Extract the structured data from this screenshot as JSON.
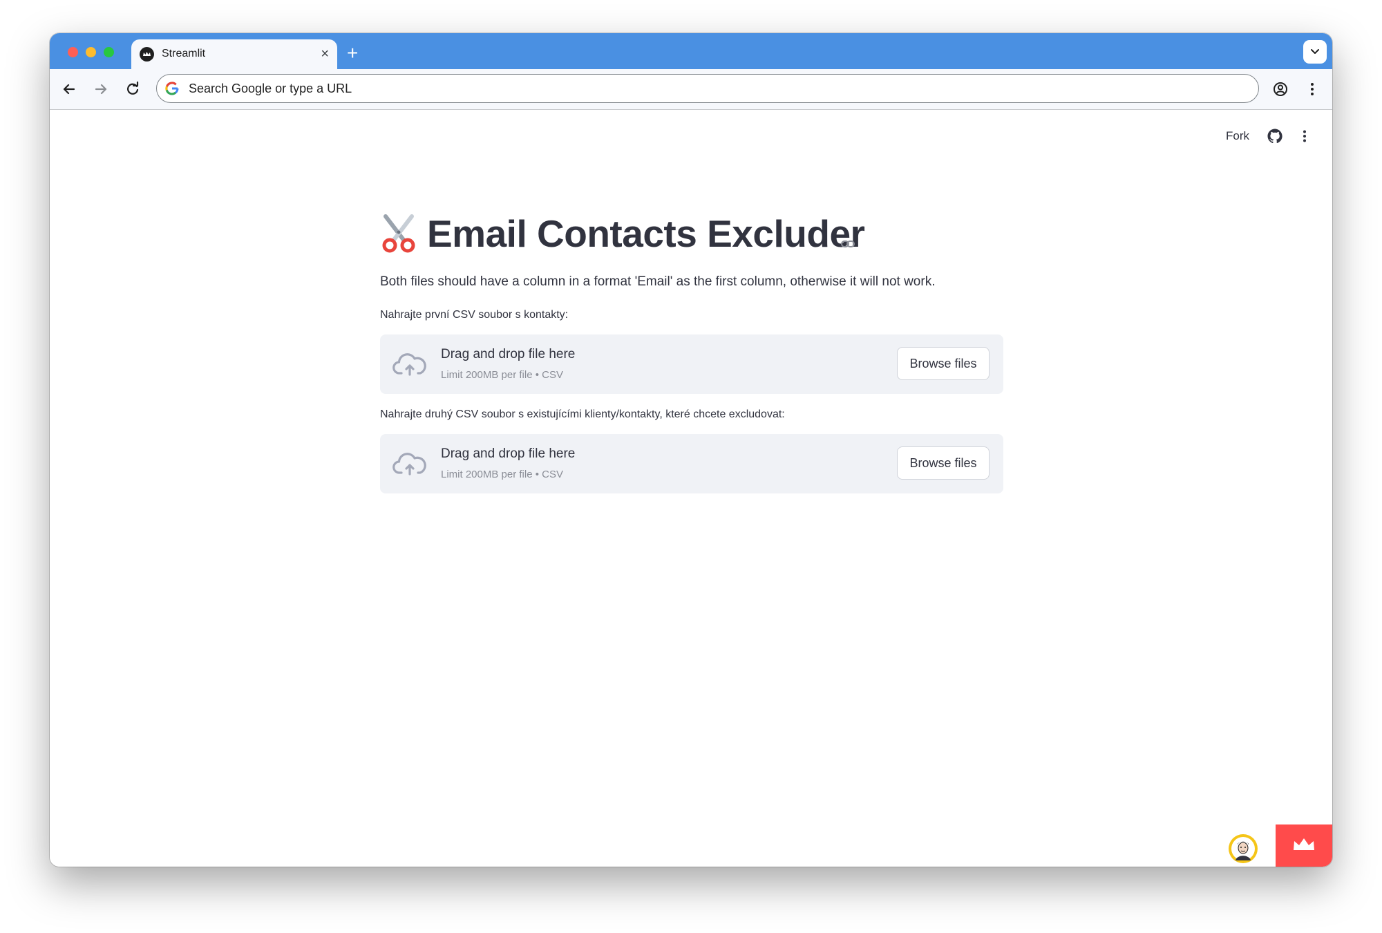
{
  "browser": {
    "tab_title": "Streamlit",
    "new_tab_symbol": "+",
    "close_symbol": "×",
    "address_placeholder": "Search Google or type a URL"
  },
  "app_header": {
    "fork_label": "Fork"
  },
  "main": {
    "title": "Email Contacts Excluder",
    "description": "Both files should have a column in a format 'Email' as the first column, otherwise it will not work."
  },
  "uploaders": [
    {
      "label": "Nahrajte první CSV soubor s kontakty:",
      "drop_text": "Drag and drop file here",
      "limit_text": "Limit 200MB per file • CSV",
      "button_label": "Browse files"
    },
    {
      "label": "Nahrajte druhý CSV soubor s existujícími klienty/kontakty, které chcete excludovat:",
      "drop_text": "Drag and drop file here",
      "limit_text": "Limit 200MB per file • CSV",
      "button_label": "Browse files"
    }
  ],
  "colors": {
    "tab_bar": "#4a90e2",
    "streamlit_red": "#ff4b4b",
    "text": "#31333f",
    "dropzone_bg": "#f0f2f6"
  },
  "icons": [
    "streamlit-favicon-icon",
    "back-arrow-icon",
    "forward-arrow-icon",
    "reload-icon",
    "google-icon",
    "profile-icon",
    "chrome-menu-icon",
    "github-icon",
    "kebab-menu-icon",
    "scissors-icon",
    "link-icon",
    "upload-cloud-icon",
    "streamlit-crown-icon"
  ]
}
